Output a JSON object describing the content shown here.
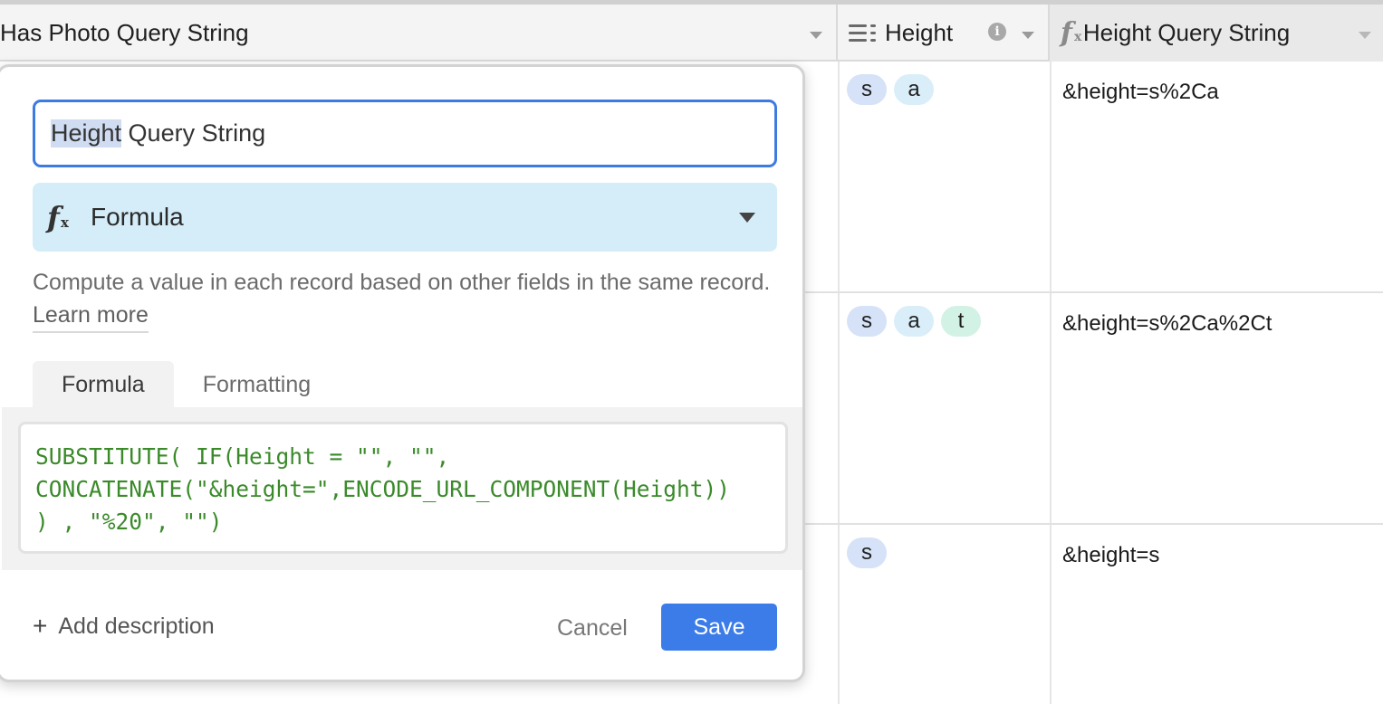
{
  "header": {
    "col1_label": "Has Photo Query String",
    "col2_label": "Height",
    "col3_label": "Height Query String"
  },
  "rows": [
    {
      "tags": [
        {
          "text": "s",
          "color": "#d6e2f7"
        },
        {
          "text": "a",
          "color": "#d9eef9"
        }
      ],
      "query_string": "&height=s%2Ca"
    },
    {
      "tags": [
        {
          "text": "s",
          "color": "#d6e2f7"
        },
        {
          "text": "a",
          "color": "#d9eef9"
        },
        {
          "text": "t",
          "color": "#d2f2e6"
        }
      ],
      "query_string": "&height=s%2Ca%2Ct"
    },
    {
      "tags": [
        {
          "text": "s",
          "color": "#d6e2f7"
        }
      ],
      "query_string": "&height=s"
    }
  ],
  "popup": {
    "field_name_selected": "Height",
    "field_name_rest": " Query String",
    "field_type": "Formula",
    "description_text": "Compute a value in each record based on other fields in the same record. ",
    "learn_more_link": "Learn more",
    "tabs": [
      "Formula",
      "Formatting"
    ],
    "formula": "SUBSTITUTE( IF(Height = \"\", \"\",\nCONCATENATE(\"&height=\",ENCODE_URL_COMPONENT(Height))\n) , \"%20\", \"\")",
    "add_description_label": "Add description",
    "cancel_label": "Cancel",
    "save_label": "Save"
  },
  "colors": {
    "accent": "#3c7ce9",
    "type_select_bg": "#d5edf9",
    "formula_text": "#3a8a2a"
  },
  "icons": {
    "height_field": "multi-select-icon",
    "info": "info-icon",
    "formula": "formula-fx-icon"
  }
}
